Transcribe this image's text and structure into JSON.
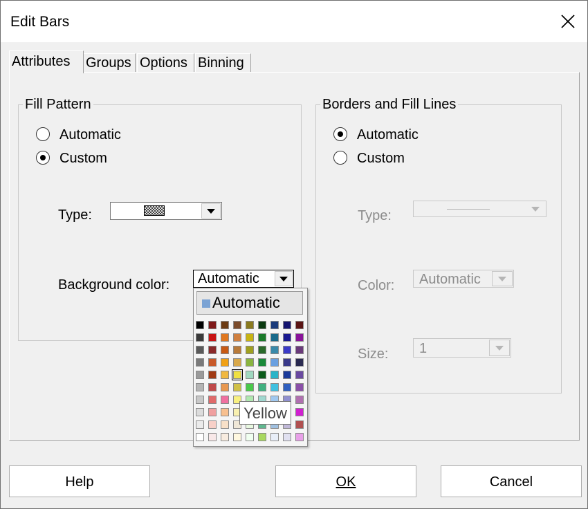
{
  "window": {
    "title": "Edit Bars"
  },
  "tabs": [
    {
      "label": "Attributes"
    },
    {
      "label": "Groups"
    },
    {
      "label": "Options"
    },
    {
      "label": "Binning"
    }
  ],
  "fill_pattern": {
    "group_label": "Fill Pattern",
    "radio_automatic": "Automatic",
    "radio_custom": "Custom",
    "selected": "Custom",
    "type_label": "Type:",
    "bg_color_label": "Background color:",
    "bg_color_value": "Automatic"
  },
  "borders": {
    "group_label": "Borders and Fill Lines",
    "radio_automatic": "Automatic",
    "radio_custom": "Custom",
    "selected": "Automatic",
    "type_label": "Type:",
    "color_label": "Color:",
    "color_value": "Automatic",
    "size_label": "Size:",
    "size_value": "1"
  },
  "color_popup": {
    "automatic_label": "Automatic",
    "automatic_color": "#7ba3d4",
    "hovered": "Yellow",
    "tooltip": "Yellow",
    "palette": [
      [
        "#000000",
        "#7f1a1a",
        "#6b3a12",
        "#7a4a2a",
        "#8a7a1f",
        "#0a3a10",
        "#1a3a7a",
        "#141470",
        "#5a1414"
      ],
      [
        "#3a3a3a",
        "#c81414",
        "#e07820",
        "#d08040",
        "#c8b414",
        "#1a7a2a",
        "#1a6a8a",
        "#1a1a90",
        "#8a149a"
      ],
      [
        "#5a5a5a",
        "#8a2a2a",
        "#c85a14",
        "#b87a3a",
        "#a0a020",
        "#2a6a2a",
        "#3a8aaa",
        "#3a3ac8",
        "#6a3a7a"
      ],
      [
        "#7a7a7a",
        "#c85a2a",
        "#f0a014",
        "#d8a84a",
        "#8ab440",
        "#1a8a3a",
        "#6aa0e0",
        "#3a3a8a",
        "#2a2a50"
      ],
      [
        "#9a9a9a",
        "#a03a14",
        "#f0b840",
        "#f0e040",
        "#a0d8c0",
        "#0a5a1a",
        "#2ab4c8",
        "#1a3a9a",
        "#6a4aa0"
      ],
      [
        "#b4b4b4",
        "#c04a4a",
        "#e89850",
        "#d0c048",
        "#4ac84a",
        "#40b080",
        "#40c0e0",
        "#3060c0",
        "#8a50a8"
      ],
      [
        "#c8c8c8",
        "#e06a6a",
        "#f070a0",
        "#f8f080",
        "#b0e8b0",
        "#a0d8d0",
        "#a0c8f0",
        "#9090d0",
        "#b070b0"
      ],
      [
        "#dcdcdc",
        "#f0a0a0",
        "#f8c090",
        "#f8f0b0",
        "#d0f0c0",
        "#c0e8e0",
        "#b0d8f8",
        "#c0c0f0",
        "#d020d0"
      ],
      [
        "#ebebeb",
        "#f8d0c8",
        "#f8e0c8",
        "#f0e8d8",
        "#e8f8e0",
        "#60b890",
        "#a0c0e0",
        "#c0b8d8",
        "#b05050"
      ],
      [
        "#ffffff",
        "#f8e8e8",
        "#f8ece0",
        "#fff8e0",
        "#f0fff0",
        "#a8d860",
        "#e8eef8",
        "#e0e0f0",
        "#e8a0e8"
      ]
    ]
  },
  "buttons": {
    "help": "Help",
    "ok": "OK",
    "cancel": "Cancel"
  }
}
